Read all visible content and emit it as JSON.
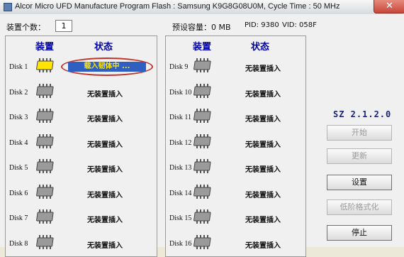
{
  "window": {
    "title": "Alcor Micro UFD Manufacture Program Flash : Samsung K9G8G08U0M, Cycle Time : 50 MHz",
    "close_symbol": "✕"
  },
  "header": {
    "device_count_label": "装置个数：",
    "device_count_value": "1",
    "capacity_label": "预设容量：0 MB",
    "pid_label": "PID: 9380",
    "vid_label": "VID: 058F"
  },
  "columns": {
    "device": "装置",
    "status": "状态"
  },
  "left_disks": [
    {
      "label": "Disk 1",
      "status": "载入韧体中 ...",
      "active": true
    },
    {
      "label": "Disk 2",
      "status": "无装置插入"
    },
    {
      "label": "Disk 3",
      "status": "无装置插入"
    },
    {
      "label": "Disk 4",
      "status": "无装置插入"
    },
    {
      "label": "Disk 5",
      "status": "无装置插入"
    },
    {
      "label": "Disk 6",
      "status": "无装置插入"
    },
    {
      "label": "Disk 7",
      "status": "无装置插入"
    },
    {
      "label": "Disk 8",
      "status": "无装置插入"
    }
  ],
  "right_disks": [
    {
      "label": "Disk 9",
      "status": "无装置插入"
    },
    {
      "label": "Disk 10",
      "status": "无装置插入"
    },
    {
      "label": "Disk 11",
      "status": "无装置插入"
    },
    {
      "label": "Disk 12",
      "status": "无装置插入"
    },
    {
      "label": "Disk 13",
      "status": "无装置插入"
    },
    {
      "label": "Disk 14",
      "status": "无装置插入"
    },
    {
      "label": "Disk 15",
      "status": "无装置插入"
    },
    {
      "label": "Disk 16",
      "status": "无装置插入"
    }
  ],
  "sidebar": {
    "version": "SZ 2.1.2.0",
    "start_button": "开始",
    "update_button": "更新",
    "settings_button": "设置",
    "low_format_button": "低阶格式化",
    "stop_button": "停止"
  },
  "colors": {
    "active_chip": "#ffe500",
    "idle_chip": "#9a9a9a",
    "active_bar": "#2f5fc0",
    "header_text": "#0000aa"
  }
}
